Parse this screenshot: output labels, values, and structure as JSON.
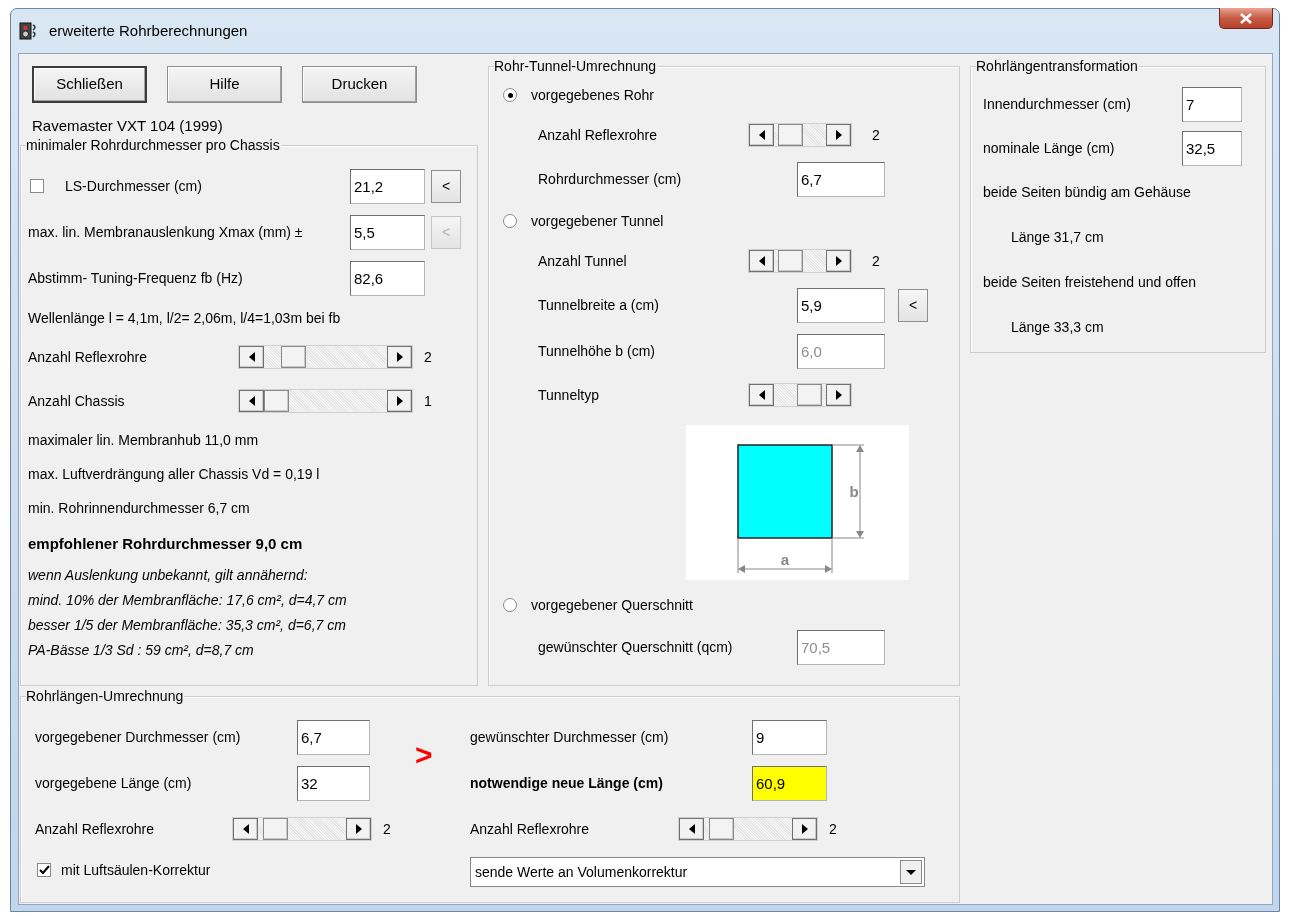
{
  "window": {
    "title": "erweiterte Rohrberechnungen"
  },
  "buttons": [
    {
      "label": "Schließen",
      "default": true
    },
    {
      "label": "Hilfe",
      "default": false
    },
    {
      "label": "Drucken",
      "default": false
    }
  ],
  "model_label": "Ravemaster VXT 104 (1999)",
  "min_diameter_group": {
    "title": "minimaler Rohrdurchmesser pro Chassis",
    "rows": [
      {
        "kind": "field",
        "checkbox": {
          "checked": false
        },
        "label": "LS-Durchmesser (cm)",
        "value": "21,2",
        "disabled": false,
        "button": {
          "label": "<",
          "disabled": false
        }
      },
      {
        "kind": "field",
        "label": "max. lin. Membranauslenkung Xmax (mm) ±",
        "value": "5,5",
        "disabled": false,
        "button": {
          "label": "<",
          "disabled": true
        }
      },
      {
        "kind": "field",
        "label": "Abstimm- Tuning-Frequenz fb (Hz)",
        "value": "82,6",
        "disabled": false
      },
      {
        "kind": "text",
        "text": "Wellenlänge l = 4,1m, l/2= 2,06m, l/4=1,03m bei fb"
      },
      {
        "kind": "scroll",
        "label": "Anzahl Reflexrohre",
        "level": 0.17,
        "reading": "2"
      },
      {
        "kind": "scroll",
        "label": "Anzahl Chassis",
        "level": 0,
        "reading": "1"
      },
      {
        "kind": "text",
        "text": "maximaler lin. Membranhub 11,0 mm"
      },
      {
        "kind": "text",
        "text": "max. Luftverdrängung aller Chassis Vd = 0,19 l"
      },
      {
        "kind": "text",
        "text": "min. Rohrinnendurchmesser 6,7 cm"
      },
      {
        "kind": "emphasis",
        "text": "empfohlener Rohrdurchmesser 9,0 cm"
      },
      {
        "kind": "note",
        "text": "wenn Auslenkung unbekannt, gilt annähernd:"
      },
      {
        "kind": "note",
        "text": "mind. 10% der Membranfläche: 17,6 cm², d=4,7 cm"
      },
      {
        "kind": "note",
        "text": "besser 1/5 der Membranfläche: 35,3 cm², d=6,7 cm"
      },
      {
        "kind": "note",
        "text": "PA-Bässe 1/3 Sd : 59 cm², d=8,7 cm"
      }
    ]
  },
  "tunnel_group": {
    "title": "Rohr-Tunnel-Umrechnung",
    "rows": [
      {
        "kind": "radio",
        "label": "vorgegebenes Rohr",
        "selected": true
      },
      {
        "kind": "scroll",
        "label": "Anzahl Reflexrohre",
        "level": 0.15,
        "reading": "2"
      },
      {
        "kind": "field",
        "label": "Rohrdurchmesser (cm)",
        "value": "6,7",
        "disabled": false
      },
      {
        "kind": "radio",
        "label": "vorgegebener Tunnel",
        "selected": false
      },
      {
        "kind": "scroll",
        "label": "Anzahl Tunnel",
        "level": 0.15,
        "reading": "2"
      },
      {
        "kind": "field",
        "label": "Tunnelbreite a (cm)",
        "value": "5,9",
        "disabled": false,
        "button": {
          "label": "<",
          "disabled": false
        }
      },
      {
        "kind": "field",
        "label": "Tunnelhöhe b (cm)",
        "value": "6,0",
        "disabled": true
      },
      {
        "kind": "scroll",
        "label": "Tunneltyp",
        "level": 0.85
      },
      {
        "kind": "diagram",
        "width_label": "a",
        "height_label": "b"
      },
      {
        "kind": "radio",
        "label": "vorgegebener Querschnitt",
        "selected": false
      },
      {
        "kind": "field",
        "label": "gewünschter Querschnitt (qcm)",
        "value": "70,5",
        "disabled": true
      }
    ]
  },
  "transform_group": {
    "title": "Rohrlängentransformation",
    "rows": [
      {
        "kind": "field",
        "label": "Innendurchmesser (cm)",
        "value": "7",
        "disabled": false
      },
      {
        "kind": "field",
        "label": "nominale Länge (cm)",
        "value": "32,5",
        "disabled": false
      },
      {
        "kind": "text",
        "text": "beide Seiten bündig am Gehäuse"
      },
      {
        "kind": "subtext",
        "text": "Länge 31,7 cm"
      },
      {
        "kind": "text",
        "text": "beide Seiten freistehend und offen"
      },
      {
        "kind": "subtext",
        "text": "Länge 33,3 cm"
      }
    ]
  },
  "length_group": {
    "title": "Rohrlängen-Umrechnung",
    "left_rows": [
      {
        "kind": "field",
        "label": "vorgegebener Durchmesser (cm)",
        "value": "6,7",
        "disabled": false
      },
      {
        "kind": "field",
        "label": "vorgegebene Länge (cm)",
        "value": "32",
        "disabled": false
      },
      {
        "kind": "scroll",
        "label": "Anzahl Reflexrohre",
        "level": 0.08,
        "reading": "2"
      },
      {
        "kind": "checkbox",
        "label": "mit Luftsäulen-Korrektur",
        "checked": true
      }
    ],
    "arrow": ">",
    "right_rows": [
      {
        "kind": "field",
        "label": "gewünschter Durchmesser (cm)",
        "value": "9",
        "disabled": false
      },
      {
        "kind": "field",
        "label": "notwendige neue Länge (cm)",
        "value": "60,9",
        "disabled": false,
        "highlighted": true,
        "bold": true
      },
      {
        "kind": "scroll",
        "label": "Anzahl Reflexrohre",
        "level": 0.08,
        "reading": "2"
      },
      {
        "kind": "dropdown",
        "value": "sende Werte an Volumenkorrektur"
      }
    ]
  }
}
